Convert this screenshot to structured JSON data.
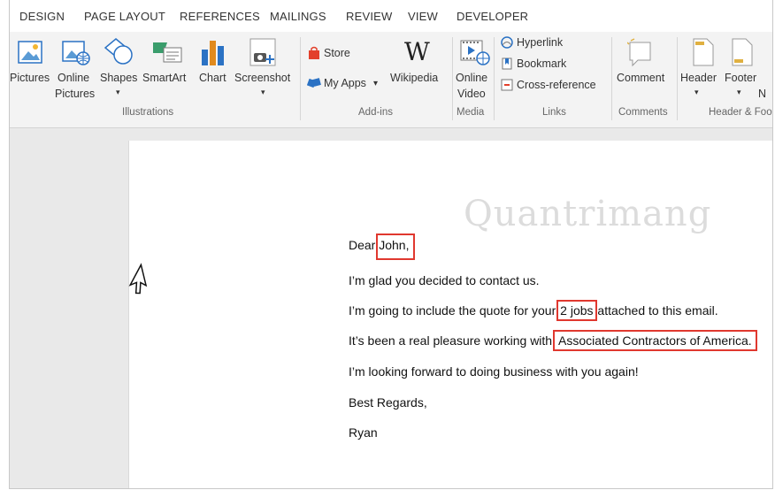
{
  "ribbon_tabs": [
    "DESIGN",
    "PAGE LAYOUT",
    "REFERENCES",
    "MAILINGS",
    "REVIEW",
    "VIEW",
    "DEVELOPER"
  ],
  "illustrations": {
    "pictures": "Pictures",
    "online_pictures_1": "Online",
    "online_pictures_2": "Pictures",
    "shapes": "Shapes",
    "smartart": "SmartArt",
    "chart": "Chart",
    "screenshot": "Screenshot",
    "group_label": "Illustrations"
  },
  "addins": {
    "store": "Store",
    "my_apps": "My Apps",
    "wikipedia": "Wikipedia",
    "group_label": "Add-ins"
  },
  "media": {
    "online_video_1": "Online",
    "online_video_2": "Video",
    "group_label": "Media"
  },
  "links": {
    "hyperlink": "Hyperlink",
    "bookmark": "Bookmark",
    "cross_reference": "Cross-reference",
    "group_label": "Links"
  },
  "comments": {
    "comment": "Comment",
    "group_label": "Comments"
  },
  "header_footer": {
    "header": "Header",
    "footer": "Footer",
    "page_number": "N",
    "group_label": "Header & Foo"
  },
  "document": {
    "watermark": "Quantrimang",
    "greeting_prefix": "Dear ",
    "greeting_name": "John,",
    "line2": "I’m glad you decided to contact us.",
    "line3_prefix": "I’m going to include the quote for your ",
    "line3_field": "2 jobs",
    "line3_suffix": " attached to this email.",
    "line4_prefix": "It’s been a real pleasure working with ",
    "line4_field": "Associated Contractors of America.",
    "line5": "I’m looking forward to doing business with you again!",
    "closing": "Best Regards,",
    "signature": "Ryan"
  },
  "colors": {
    "highlight_box": "#e0382f",
    "chart_bar": "#e08a1e",
    "accent_blue": "#2b72c4"
  }
}
